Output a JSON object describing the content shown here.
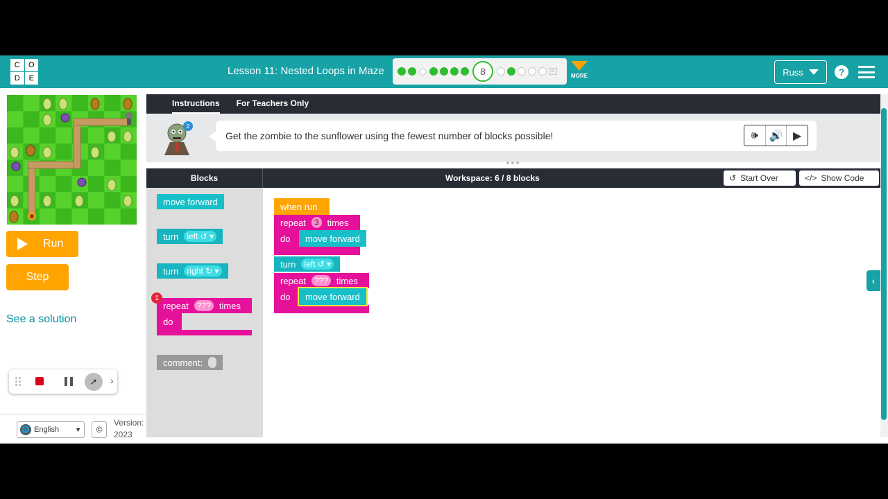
{
  "logo": {
    "letters": [
      "C",
      "O",
      "D",
      "E"
    ]
  },
  "header": {
    "lesson_title": "Lesson 11: Nested Loops in Maze",
    "current_level": "8",
    "more_label": "MORE",
    "user_name": "Russ",
    "help_label": "?",
    "progress_before": [
      "done",
      "done",
      "diamond",
      "done",
      "done",
      "done",
      "done"
    ],
    "progress_after": [
      "empty",
      "done",
      "done",
      "empty",
      "empty",
      "empty",
      "box"
    ]
  },
  "controls": {
    "run_label": "Run",
    "step_label": "Step",
    "solution_link": "See a solution"
  },
  "footer": {
    "language": "English",
    "copyright_icon": "©",
    "version_label": "Version:",
    "version_year": "2023"
  },
  "instructions": {
    "tabs": [
      "Instructions",
      "For Teachers Only"
    ],
    "active_tab": "Instructions",
    "text": "Get the zombie to the sunflower using the fewest number of blocks possible!",
    "badge_count": "2"
  },
  "workspace": {
    "toolbox_title": "Blocks",
    "count_label": "Workspace: 6 / 8 blocks",
    "start_over": "Start Over",
    "show_code": "Show Code"
  },
  "toolbox_blocks": {
    "move_forward": "move forward",
    "turn_left_a": "turn",
    "turn_left_b": "left ↺",
    "turn_right_a": "turn",
    "turn_right_b": "right ↻",
    "repeat_a": "repeat",
    "repeat_b": "???",
    "repeat_c": "times",
    "repeat_do": "do",
    "repeat_warning": "1",
    "comment": "comment:"
  },
  "program": {
    "when_run": "when run",
    "r1_a": "repeat",
    "r1_n": "3",
    "r1_b": "times",
    "r1_do": "do",
    "r1_body": "move forward",
    "turn_a": "turn",
    "turn_b": "left ↺",
    "r2_a": "repeat",
    "r2_n": "???",
    "r2_b": "times",
    "r2_do": "do",
    "r2_body": "move forward"
  },
  "colors": {
    "header": "#17a2a6",
    "run_button": "#ffa400",
    "move_block": "#17c0c9",
    "repeat_block": "#e6119a",
    "event_block": "#ffa400",
    "grass_light": "#57d12b",
    "grass_dark": "#3ab81d"
  }
}
